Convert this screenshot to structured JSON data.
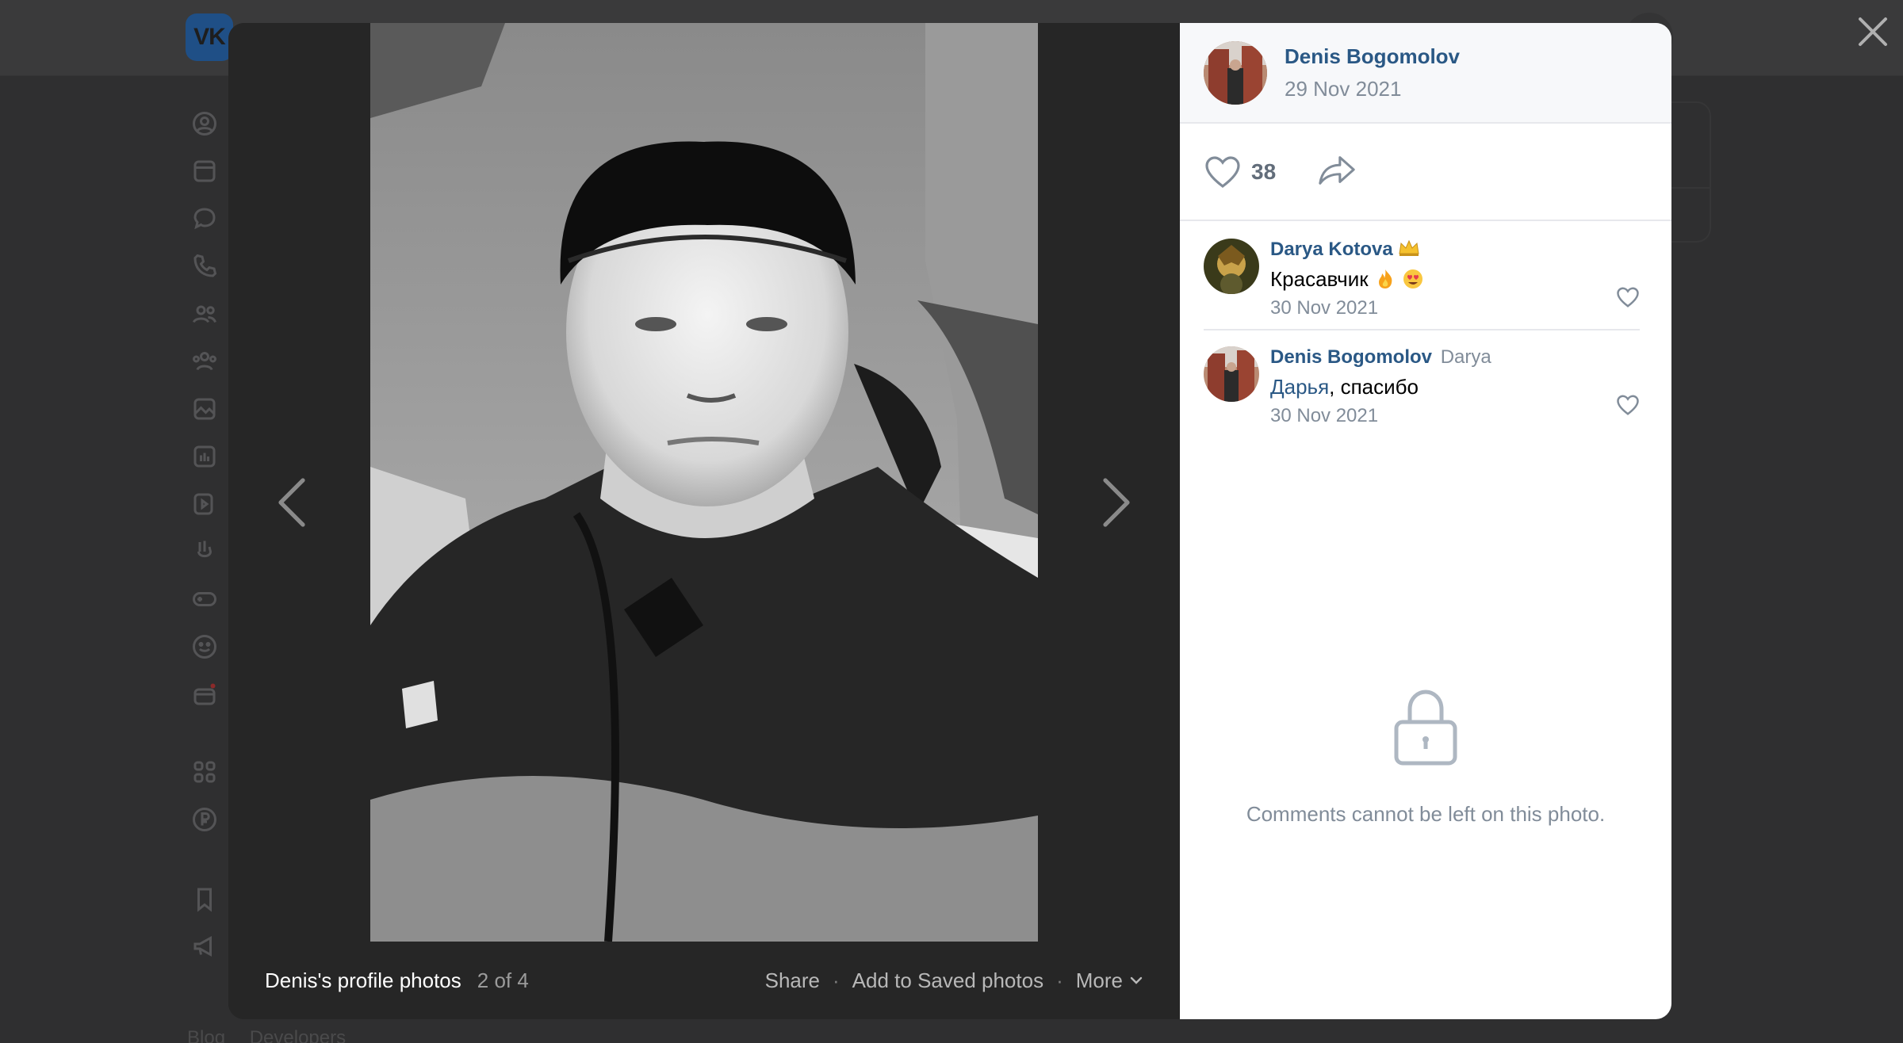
{
  "viewer": {
    "album_title": "Denis's profile photos",
    "album_count": "2 of 4",
    "actions": [
      "Share",
      "Add to Saved photos",
      "More"
    ]
  },
  "side_panel": {
    "author_name": "Denis Bogomolov",
    "post_date": "29 Nov 2021",
    "like_count": "38",
    "comments": [
      {
        "author": "Darya Kotova",
        "text": "Красавчик",
        "date": "30 Nov 2021"
      },
      {
        "author": "Denis Bogomolov",
        "reply_to": "Darya",
        "mention": "Дарья",
        "text_rest": ", спасибо",
        "date": "30 Nov 2021"
      }
    ],
    "locked_message": "Comments cannot be left on this photo."
  },
  "background": {
    "footer_links": [
      "Blog",
      "Developers"
    ]
  },
  "colors": {
    "link": "#2a5885",
    "muted": "#818c99",
    "overlay": "#2f2f30",
    "viewer_bg": "#262626"
  }
}
